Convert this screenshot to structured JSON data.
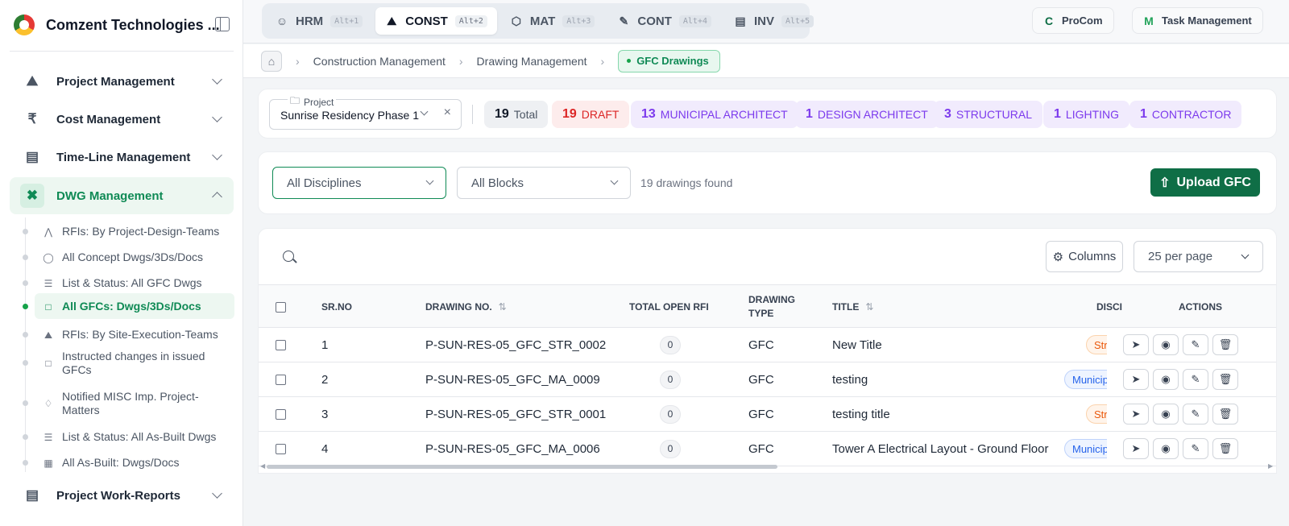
{
  "sidebar": {
    "brand": "Comzent Technologies ...",
    "menu": [
      {
        "label": "Project Management",
        "icon": "hardhat-icon"
      },
      {
        "label": "Cost Management",
        "icon": "rupee-icon"
      },
      {
        "label": "Time-Line Management",
        "icon": "calendar-icon"
      },
      {
        "label": "DWG Management",
        "icon": "drafting-icon"
      },
      {
        "label": "Project Work-Reports",
        "icon": "clipboard-icon"
      }
    ],
    "submenu": [
      {
        "label": "RFIs: By Project-Design-Teams",
        "icon": "compass-icon"
      },
      {
        "label": "All Concept Dwgs/3Ds/Docs",
        "icon": "bulb-icon"
      },
      {
        "label": "List & Status: All GFC Dwgs",
        "icon": "checklist-icon"
      },
      {
        "label": "All GFCs: Dwgs/3Ds/Docs",
        "icon": "file-check-icon"
      },
      {
        "label": "RFIs: By Site-Execution-Teams",
        "icon": "hardhat-icon"
      },
      {
        "label": "Instructed changes in issued GFCs",
        "icon": "file-icon"
      },
      {
        "label": "Notified MISC Imp. Project-Matters",
        "icon": "bell-icon"
      },
      {
        "label": "List & Status: All As-Built Dwgs",
        "icon": "checklist-icon"
      },
      {
        "label": "All As-Built: Dwgs/Docs",
        "icon": "building-icon"
      }
    ]
  },
  "topbar": {
    "modules": [
      {
        "label": "HRM",
        "shortcut": "Alt+1",
        "icon": "users-icon"
      },
      {
        "label": "CONST",
        "shortcut": "Alt+2",
        "icon": "hardhat-icon"
      },
      {
        "label": "MAT",
        "shortcut": "Alt+3",
        "icon": "box-icon"
      },
      {
        "label": "CONT",
        "shortcut": "Alt+4",
        "icon": "file-edit-icon"
      },
      {
        "label": "INV",
        "shortcut": "Alt+5",
        "icon": "file-text-icon"
      }
    ],
    "procom": "ProCom",
    "task_management": "Task Management"
  },
  "breadcrumb": {
    "items": [
      "Construction Management",
      "Drawing Management"
    ],
    "current": "GFC Drawings"
  },
  "summary": {
    "project_label": "Project",
    "project_value": "Sunrise Residency Phase 1",
    "stats": [
      {
        "count": "19",
        "label": "Total"
      },
      {
        "count": "19",
        "label": "DRAFT"
      },
      {
        "count": "13",
        "label": "MUNICIPAL ARCHITECT"
      },
      {
        "count": "1",
        "label": "DESIGN ARCHITECT"
      },
      {
        "count": "3",
        "label": "STRUCTURAL"
      },
      {
        "count": "1",
        "label": "LIGHTING"
      },
      {
        "count": "1",
        "label": "CONTRACTOR"
      }
    ]
  },
  "filters": {
    "discipline": "All Disciplines",
    "block": "All Blocks",
    "found": "19 drawings found",
    "upload": "Upload GFC"
  },
  "table": {
    "columns_btn": "Columns",
    "per_page": "25 per page",
    "headers": {
      "srno": "SR.NO",
      "drawing_no": "DRAWING NO.",
      "open_rfi": "TOTAL OPEN RFI",
      "drawing_type": "DRAWING TYPE",
      "title": "TITLE",
      "discipline": "DISCI",
      "actions": "ACTIONS"
    },
    "rows": [
      {
        "sr": "1",
        "drawing_no": "P-SUN-RES-05_GFC_STR_0002",
        "rfi": "0",
        "type": "GFC",
        "title": "New Title",
        "discipline": "Str"
      },
      {
        "sr": "2",
        "drawing_no": "P-SUN-RES-05_GFC_MA_0009",
        "rfi": "0",
        "type": "GFC",
        "title": "testing",
        "discipline": "Municip"
      },
      {
        "sr": "3",
        "drawing_no": "P-SUN-RES-05_GFC_STR_0001",
        "rfi": "0",
        "type": "GFC",
        "title": "testing title",
        "discipline": "Str"
      },
      {
        "sr": "4",
        "drawing_no": "P-SUN-RES-05_GFC_MA_0006",
        "rfi": "0",
        "type": "GFC",
        "title": "Tower A Electrical Layout - Ground Floor",
        "discipline": "Municip"
      }
    ]
  },
  "colors": {
    "brand_green": "#0f6e46",
    "active_green": "#0f8a55",
    "draft_red": "#dc2626",
    "role_purple": "#7c3aed"
  }
}
